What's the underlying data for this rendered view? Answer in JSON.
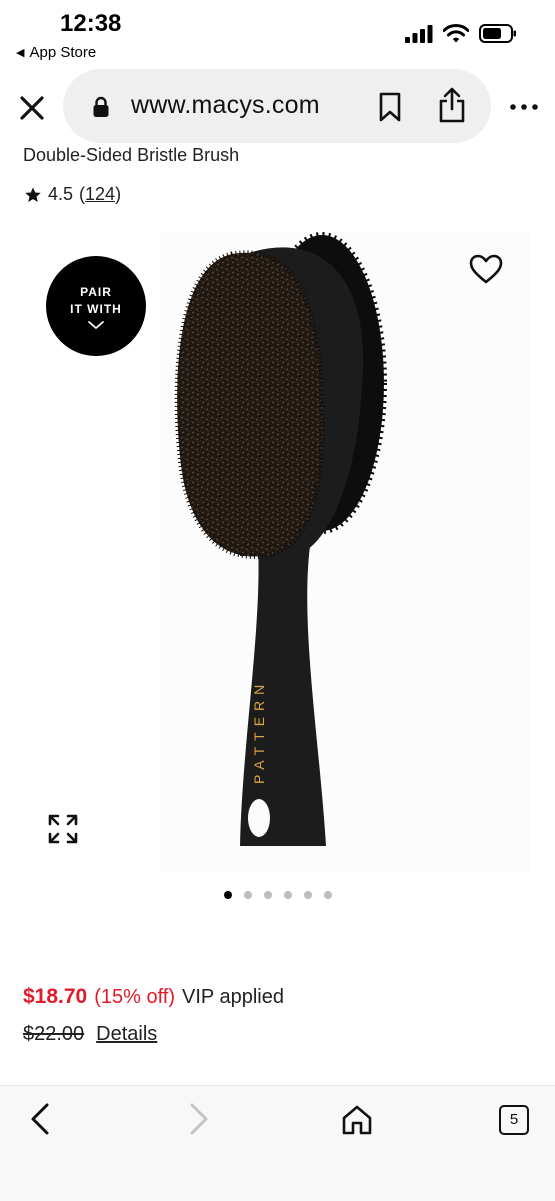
{
  "status_bar": {
    "time": "12:38",
    "back_app": "App Store",
    "icons": [
      "signal-icon",
      "wifi-icon",
      "battery-icon"
    ]
  },
  "browser": {
    "url": "www.macys.com",
    "icons": [
      "close-icon",
      "lock-icon",
      "bookmark-icon",
      "share-icon",
      "more-icon"
    ]
  },
  "product": {
    "title": "Double-Sided Bristle Brush",
    "rating_value": "4.5",
    "rating_open": "(",
    "rating_count": "124",
    "rating_close": ")",
    "badge_line1": "PAIR",
    "badge_line2": "IT WITH",
    "image_brand_text": "PATTERN",
    "image_count": 6,
    "active_image": 1,
    "sale_price": "$18.70",
    "discount": "(15% off)",
    "vip_text": "VIP applied",
    "original_price": "$22.00",
    "details_label": "Details",
    "colors": {
      "sale": "#e21a2c",
      "brush": "#1c1c1c",
      "brand_text": "#d9a441"
    }
  },
  "toolbar": {
    "tabs_count": "5",
    "icons": [
      "back-arrow-icon",
      "forward-arrow-icon",
      "home-icon",
      "tabs-icon"
    ]
  }
}
